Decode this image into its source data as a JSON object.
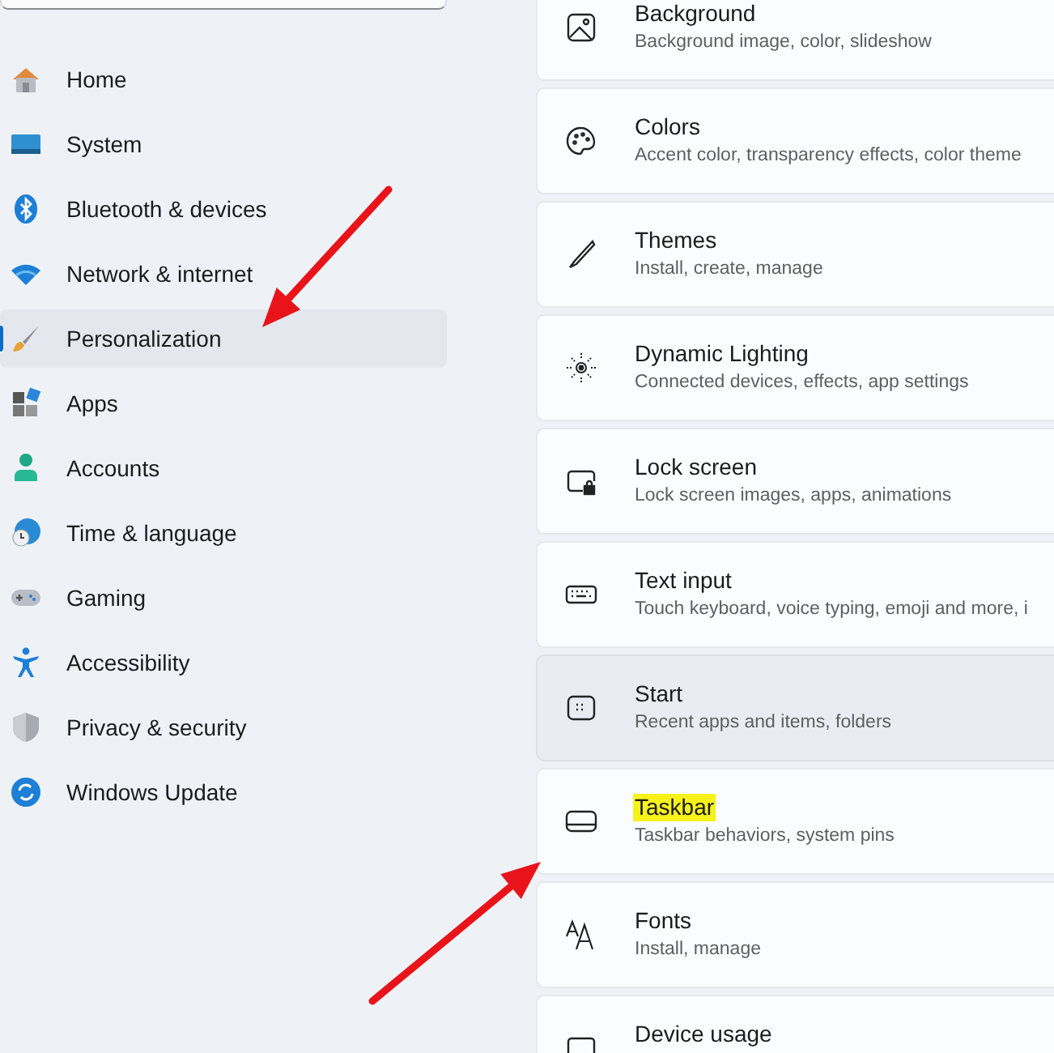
{
  "sidebar": {
    "items": [
      {
        "label": "Home",
        "selected": false
      },
      {
        "label": "System",
        "selected": false
      },
      {
        "label": "Bluetooth & devices",
        "selected": false
      },
      {
        "label": "Network & internet",
        "selected": false
      },
      {
        "label": "Personalization",
        "selected": true
      },
      {
        "label": "Apps",
        "selected": false
      },
      {
        "label": "Accounts",
        "selected": false
      },
      {
        "label": "Time & language",
        "selected": false
      },
      {
        "label": "Gaming",
        "selected": false
      },
      {
        "label": "Accessibility",
        "selected": false
      },
      {
        "label": "Privacy & security",
        "selected": false
      },
      {
        "label": "Windows Update",
        "selected": false
      }
    ]
  },
  "settings": [
    {
      "title": "Background",
      "description": "Background image, color, slideshow",
      "hovered": false,
      "highlighted": false
    },
    {
      "title": "Colors",
      "description": "Accent color, transparency effects, color theme",
      "hovered": false,
      "highlighted": false
    },
    {
      "title": "Themes",
      "description": "Install, create, manage",
      "hovered": false,
      "highlighted": false
    },
    {
      "title": "Dynamic Lighting",
      "description": "Connected devices, effects, app settings",
      "hovered": false,
      "highlighted": false
    },
    {
      "title": "Lock screen",
      "description": "Lock screen images, apps, animations",
      "hovered": false,
      "highlighted": false
    },
    {
      "title": "Text input",
      "description": "Touch keyboard, voice typing, emoji and more, i",
      "hovered": false,
      "highlighted": false
    },
    {
      "title": "Start",
      "description": "Recent apps and items, folders",
      "hovered": true,
      "highlighted": false
    },
    {
      "title": "Taskbar",
      "description": "Taskbar behaviors, system pins",
      "hovered": false,
      "highlighted": true
    },
    {
      "title": "Fonts",
      "description": "Install, manage",
      "hovered": false,
      "highlighted": false
    },
    {
      "title": "Device usage",
      "hovered": false,
      "highlighted": false
    }
  ],
  "annotations": [
    {
      "kind": "arrow"
    },
    {
      "kind": "arrow"
    }
  ]
}
